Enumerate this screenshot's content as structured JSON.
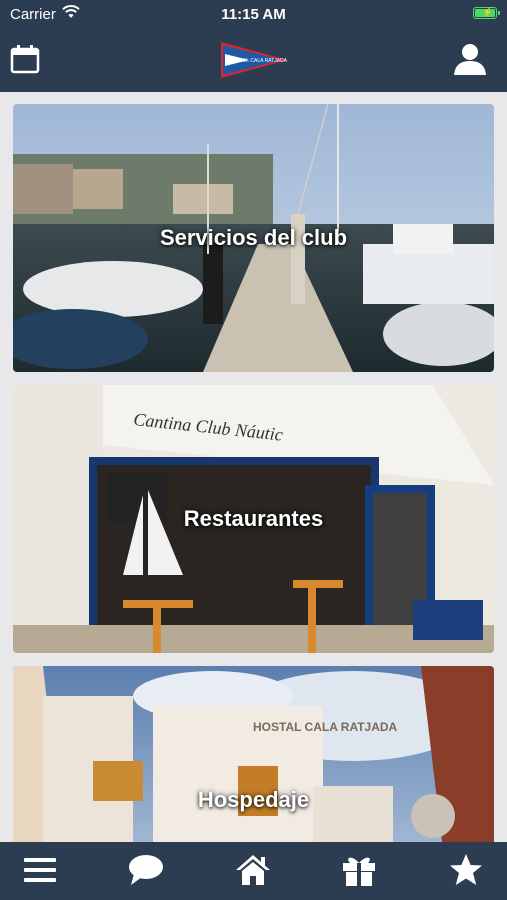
{
  "status_bar": {
    "carrier": "Carrier",
    "time": "11:15 AM"
  },
  "nav_bar": {
    "left_icon": "calendar-icon",
    "logo_text": "C.N. CALA RATJADA",
    "right_icon": "user-icon"
  },
  "cards": [
    {
      "label": "Servicios del club"
    },
    {
      "label": "Restaurantes",
      "awning_text": "Cantina Club Náutic"
    },
    {
      "label": "Hospedaje",
      "sign_text": "HOSTAL CALA RATJADA"
    }
  ],
  "tabs": [
    {
      "icon": "menu-icon"
    },
    {
      "icon": "chat-icon"
    },
    {
      "icon": "home-icon"
    },
    {
      "icon": "gift-icon"
    },
    {
      "icon": "star-icon"
    }
  ],
  "colors": {
    "bar": "#2d3d51",
    "background": "#e8e8ea",
    "battery": "#4cd964"
  }
}
